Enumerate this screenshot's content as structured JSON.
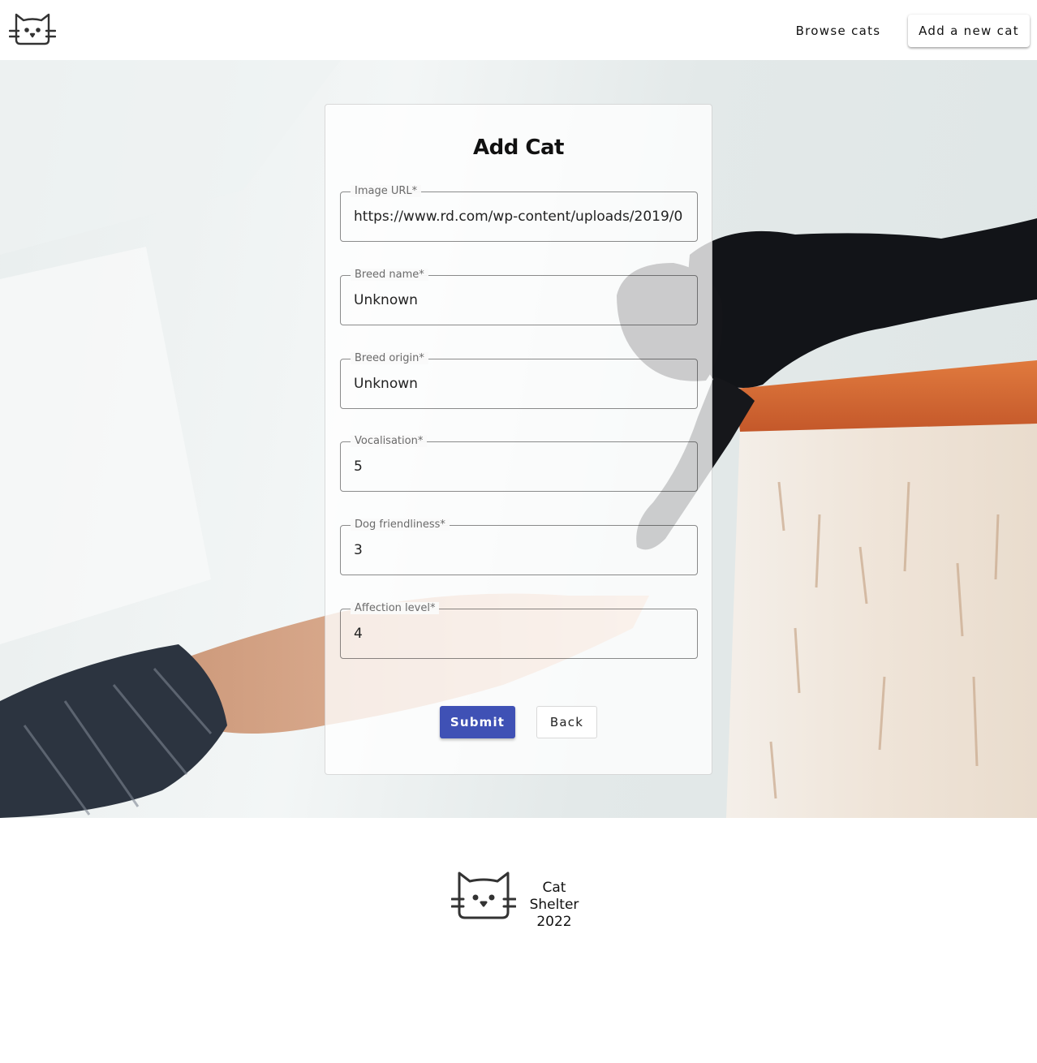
{
  "header": {
    "logo_icon": "cat-face-icon",
    "nav": {
      "browse_label": "Browse cats",
      "add_label": "Add a new cat"
    }
  },
  "form": {
    "title": "Add Cat",
    "fields": [
      {
        "label": "Image URL*",
        "value": "https://www.rd.com/wp-content/uploads/2019/0"
      },
      {
        "label": "Breed name*",
        "value": "Unknown"
      },
      {
        "label": "Breed origin*",
        "value": "Unknown"
      },
      {
        "label": "Vocalisation*",
        "value": "5"
      },
      {
        "label": "Dog friendliness*",
        "value": "3"
      },
      {
        "label": "Affection level*",
        "value": "4"
      }
    ],
    "submit_label": "Submit",
    "back_label": "Back"
  },
  "footer": {
    "logo_icon": "cat-face-icon",
    "name": "Cat Shelter",
    "year": "2022"
  },
  "colors": {
    "primary": "#3f51b5",
    "text": "#111111",
    "label": "#6b6b6b"
  }
}
